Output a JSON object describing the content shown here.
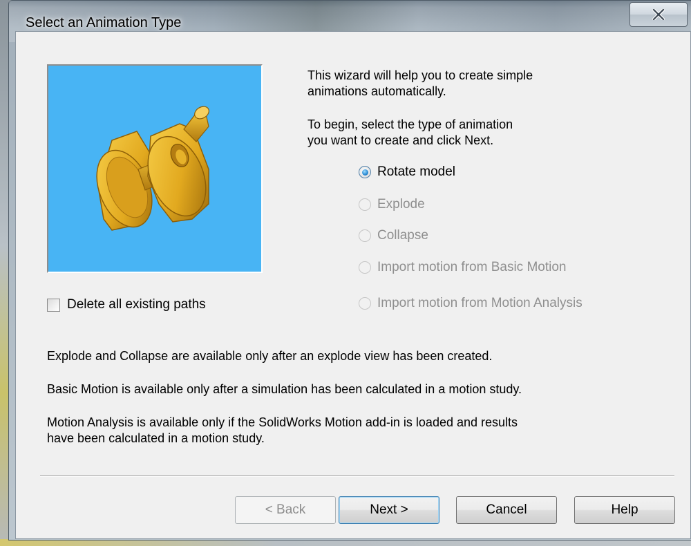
{
  "window": {
    "title": "Select an Animation Type"
  },
  "intro": {
    "line1": "This wizard will help you to create simple",
    "line2": "animations automatically.",
    "line3": "To begin, select the type of animation",
    "line4": "you want to create and click Next."
  },
  "preview": {
    "background_color": "#48b4f4",
    "model_color": "#e8b226",
    "icon": "gear-part-model"
  },
  "animation_types": [
    {
      "label": "Rotate model",
      "selected": true,
      "enabled": true
    },
    {
      "label": "Explode",
      "selected": false,
      "enabled": false
    },
    {
      "label": "Collapse",
      "selected": false,
      "enabled": false
    },
    {
      "label": "Import motion from Basic Motion",
      "selected": false,
      "enabled": false
    },
    {
      "label": "Import motion from Motion Analysis",
      "selected": false,
      "enabled": false
    }
  ],
  "options": {
    "delete_paths_label": "Delete all existing paths",
    "delete_paths_checked": false
  },
  "notes": {
    "note1": "Explode and Collapse are available only after an explode view has been created.",
    "note2": "Basic Motion is available only after a simulation has been calculated in a motion study.",
    "note3_line1": "Motion Analysis is available only if the SolidWorks Motion add-in is loaded and results",
    "note3_line2": "have been calculated in a motion study."
  },
  "buttons": {
    "back": "< Back",
    "next": "Next >",
    "cancel": "Cancel",
    "help": "Help"
  }
}
